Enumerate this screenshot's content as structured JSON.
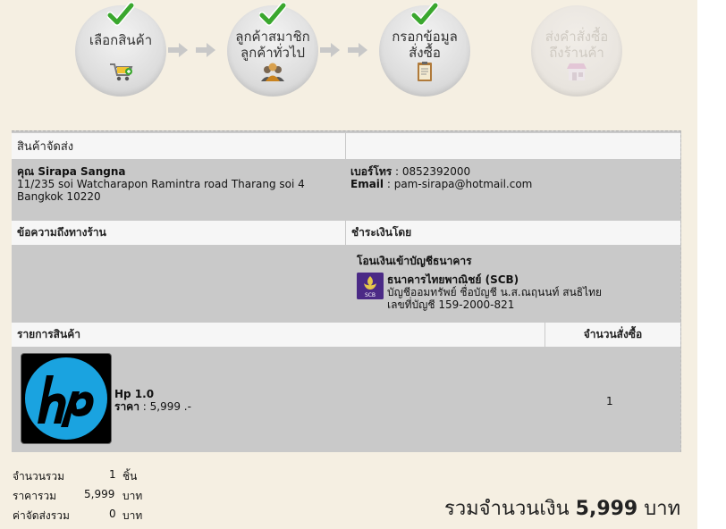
{
  "steps": [
    {
      "label_line1": "เลือกสินค้า",
      "label_line2": "",
      "done": true,
      "icon": "cart-icon"
    },
    {
      "label_line1": "ลูกค้าสมาชิก",
      "label_line2": "ลูกค้าทั่วไป",
      "done": true,
      "icon": "users-icon"
    },
    {
      "label_line1": "กรอกข้อมูล",
      "label_line2": "สั่งซื้อ",
      "done": true,
      "icon": "clipboard-icon"
    },
    {
      "label_line1": "ส่งคำสั่งซื้อ",
      "label_line2": "ถึงร้านค้า",
      "done": false,
      "icon": "shop-icon"
    }
  ],
  "shipping": {
    "header": "สินค้าจัดส่ง",
    "name": "คุณ Sirapa Sangna",
    "address_line1": "11/235 soi Watcharapon Ramintra road Tharang soi 4",
    "address_line2": "Bangkok 10220",
    "phone_label": "เบอร์โทร",
    "phone_value": " : 0852392000",
    "email_label": "Email",
    "email_value": " : pam-sirapa@hotmail.com"
  },
  "message": {
    "header": "ข้อความถึงทางร้าน"
  },
  "payment": {
    "header": "ชำระเงินโดย",
    "method": "โอนเงินเข้าบัญชีธนาคาร",
    "bank_name": "ธนาคารไทยพาณิชย์ (SCB)",
    "account_name": "บัญชีออมทรัพย์ ชื่อบัญชี น.ส.ณฤนนท์ สนธิไทย",
    "account_number": "เลขที่บัญชี 159-2000-821",
    "bank_logo_text": "SCB"
  },
  "items": {
    "header_product": "รายการสินค้า",
    "header_qty": "จำนวนสั่งซื้อ",
    "rows": [
      {
        "name": "Hp 1.0",
        "price_label": "ราคา",
        "price": " : 5,999 .-",
        "qty": "1",
        "image": "hp-logo"
      }
    ]
  },
  "summary": {
    "count_label": "จำนวนรวม",
    "count_value": "1",
    "count_unit": "ชิ้น",
    "total_label": "ราคารวม",
    "total_value": "5,999",
    "total_unit": "บาท",
    "shipping_label": "ค่าจัดส่งรวม",
    "shipping_value": "0",
    "shipping_unit": "บาท",
    "grand_prefix": "รวมจำนวนเงิน",
    "grand_value": "5,999",
    "grand_unit": "บาท"
  },
  "colors": {
    "scb_purple": "#4b2a86",
    "hp_blue": "#1aa3e0",
    "check_green": "#3aa72e"
  }
}
